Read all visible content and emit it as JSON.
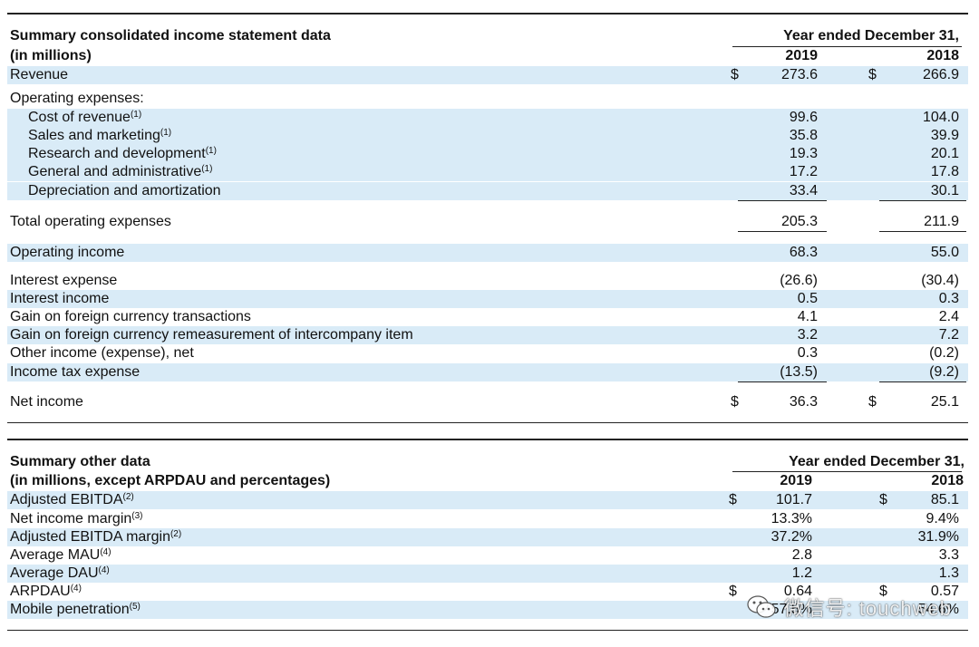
{
  "table1": {
    "title_line1": "Summary consolidated income statement data",
    "title_line2": "(in millions)",
    "period_header": "Year ended December 31,",
    "year1": "2019",
    "year2": "2018",
    "rows": [
      {
        "label": "Revenue",
        "note": "",
        "v1": "273.6",
        "v2": "266.9",
        "cur": "$"
      },
      {
        "label": "Operating expenses:",
        "note": "",
        "v1": "",
        "v2": "",
        "cur": ""
      },
      {
        "label": "Cost of revenue",
        "note": "(1)",
        "v1": "99.6",
        "v2": "104.0",
        "cur": ""
      },
      {
        "label": "Sales and marketing",
        "note": "(1)",
        "v1": "35.8",
        "v2": "39.9",
        "cur": ""
      },
      {
        "label": "Research and development",
        "note": "(1)",
        "v1": "19.3",
        "v2": "20.1",
        "cur": ""
      },
      {
        "label": "General and administrative",
        "note": "(1)",
        "v1": "17.2",
        "v2": "17.8",
        "cur": ""
      },
      {
        "label": "Depreciation and amortization",
        "note": "",
        "v1": "33.4",
        "v2": "30.1",
        "cur": ""
      },
      {
        "label": "Total operating expenses",
        "note": "",
        "v1": "205.3",
        "v2": "211.9",
        "cur": ""
      },
      {
        "label": "Operating income",
        "note": "",
        "v1": "68.3",
        "v2": "55.0",
        "cur": ""
      },
      {
        "label": "Interest expense",
        "note": "",
        "v1": "(26.6)",
        "v2": "(30.4)",
        "cur": ""
      },
      {
        "label": "Interest income",
        "note": "",
        "v1": "0.5",
        "v2": "0.3",
        "cur": ""
      },
      {
        "label": "Gain on foreign currency transactions",
        "note": "",
        "v1": "4.1",
        "v2": "2.4",
        "cur": ""
      },
      {
        "label": "Gain on foreign currency remeasurement of intercompany item",
        "note": "",
        "v1": "3.2",
        "v2": "7.2",
        "cur": ""
      },
      {
        "label": "Other income (expense), net",
        "note": "",
        "v1": "0.3",
        "v2": "(0.2)",
        "cur": ""
      },
      {
        "label": "Income tax expense",
        "note": "",
        "v1": "(13.5)",
        "v2": "(9.2)",
        "cur": ""
      },
      {
        "label": "Net income",
        "note": "",
        "v1": "36.3",
        "v2": "25.1",
        "cur": "$"
      }
    ]
  },
  "table2": {
    "title_line1": "Summary other data",
    "title_line2": "(in millions, except ARPDAU and percentages)",
    "period_header": "Year ended December 31,",
    "year1": "2019",
    "year2": "2018",
    "rows": [
      {
        "label": "Adjusted EBITDA",
        "note": "(2)",
        "v1": "101.7",
        "v2": "85.1",
        "cur": "$"
      },
      {
        "label": "Net income margin",
        "note": "(3)",
        "v1": "13.3%",
        "v2": "9.4%",
        "cur": ""
      },
      {
        "label": "Adjusted EBITDA margin",
        "note": "(2)",
        "v1": "37.2%",
        "v2": "31.9%",
        "cur": ""
      },
      {
        "label": "Average MAU",
        "note": "(4)",
        "v1": "2.8",
        "v2": "3.3",
        "cur": ""
      },
      {
        "label": "Average DAU",
        "note": "(4)",
        "v1": "1.2",
        "v2": "1.3",
        "cur": ""
      },
      {
        "label": "ARPDAU",
        "note": "(4)",
        "v1": "0.64",
        "v2": "0.57",
        "cur": "$"
      },
      {
        "label": "Mobile penetration",
        "note": "(5)",
        "v1": "57.5%",
        "v2": "54.6%",
        "cur": ""
      }
    ]
  },
  "watermark": {
    "text": "微信号: touchweb",
    "icon": "wechat-icon"
  },
  "colors": {
    "shade": "#d9ebf7",
    "rule": "#222222"
  }
}
